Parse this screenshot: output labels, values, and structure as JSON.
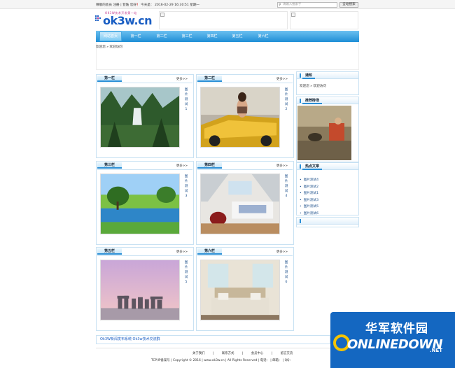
{
  "topbar": {
    "welcome": "尊敬的会员",
    "register": "注册",
    "sep1": "|",
    "login": "登陆",
    "msg_prefix": "您好",
    "msg_bold": "！",
    "today_label": "今天是：",
    "datetime": "2016-02-29 16:30:51",
    "weekday": "星期一",
    "search_placeholder": "请输入搜索字",
    "search_button": "全站搜索"
  },
  "header": {
    "tagline": "OK3W技术开发第一站",
    "logo_text": "ok3w.cn"
  },
  "nav": {
    "items": [
      "网站首页",
      "第一栏",
      "第二栏",
      "第三栏",
      "第四栏",
      "第五栏",
      "第六栏"
    ]
  },
  "breadcrumb": "欢迎您 » 欢迎访问",
  "panels": [
    {
      "title": "第一栏",
      "more": "更多>>",
      "caption": "图片测试1",
      "scene": "waterfall"
    },
    {
      "title": "第二栏",
      "more": "更多>>",
      "caption": "图片测试2",
      "scene": "car"
    },
    {
      "title": "第三栏",
      "more": "更多>>",
      "caption": "图片测试3",
      "scene": "golf"
    },
    {
      "title": "第四栏",
      "more": "更多>>",
      "caption": "图片测试4",
      "scene": "attic"
    },
    {
      "title": "第五栏",
      "more": "更多>>",
      "caption": "图片测试5",
      "scene": "stonehenge"
    },
    {
      "title": "第六栏",
      "more": "更多>>",
      "caption": "图片测试6",
      "scene": "bedroom"
    }
  ],
  "sidebar": {
    "notice_title": "通知",
    "notice_text": "欢迎您 » 欢迎访问",
    "recommend_title": "推荐砖场",
    "hot_title": "热点文章",
    "hot_items": [
      "图片测试4",
      "图片测试2",
      "图片测试1",
      "图片测试3",
      "图片测试5",
      "图片测试6"
    ]
  },
  "footer": {
    "link_text": "Ok3W新闻发布系统 Ok3w技术交流群",
    "links": [
      "关于我们",
      "|",
      "联系方式",
      "|",
      "会员中心",
      "|",
      "留言交流"
    ],
    "copyright": "TCP/IP备案号 | Copyright © 2016 | www.ok3w.cn | All Rights Reserved | 电话： | 邮箱： | QQ:"
  },
  "watermark": {
    "cn": "华军软件园",
    "en": "ONLINEDOWN",
    "net": ".NET"
  },
  "colors": {
    "accent": "#2b8fd6",
    "nav": "#1f8ed6",
    "watermark": "#1467c1"
  }
}
